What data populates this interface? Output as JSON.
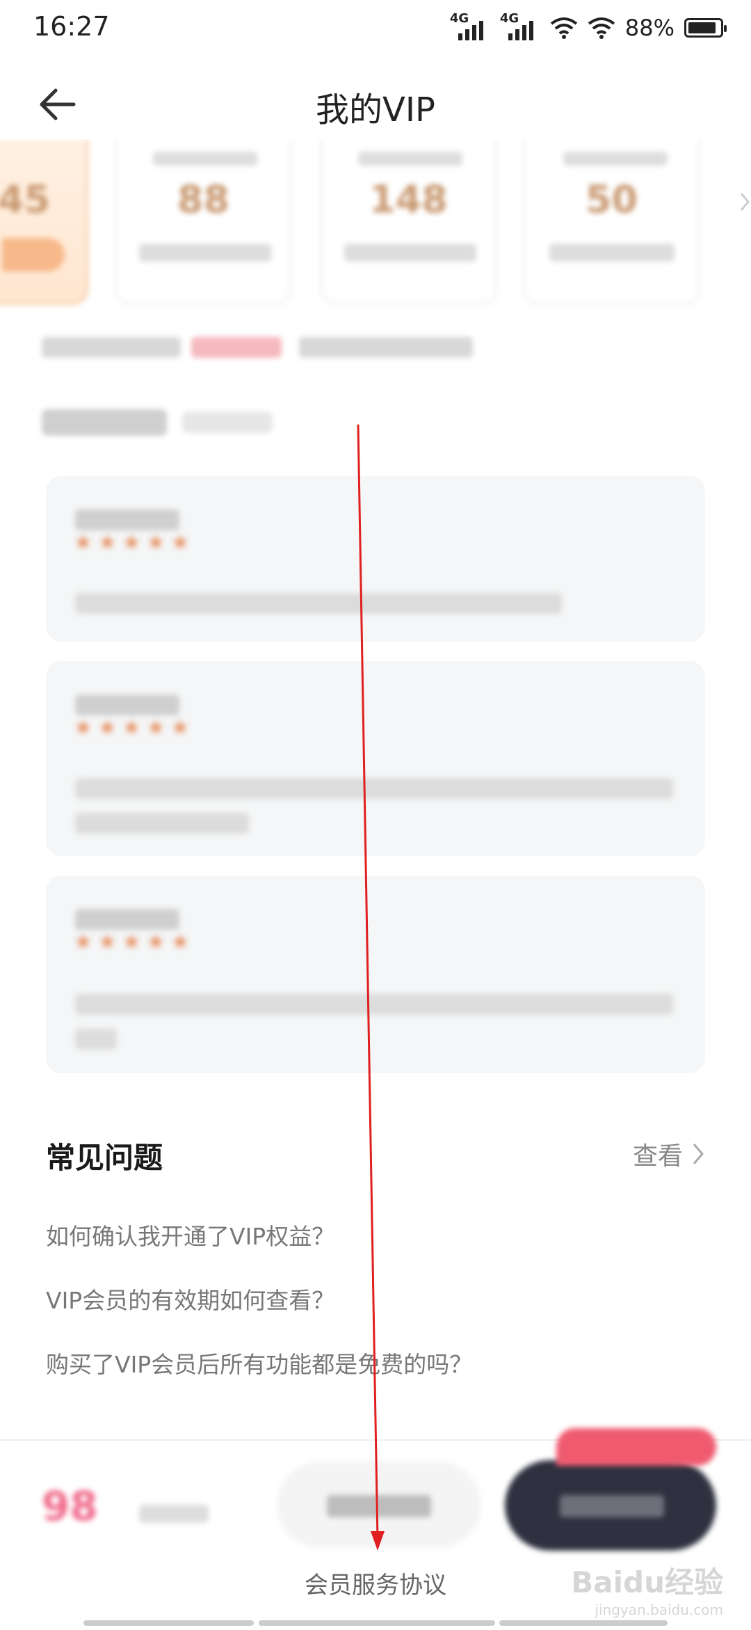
{
  "status_bar": {
    "time": "16:27",
    "net1": "4G",
    "net2": "4G",
    "battery_text": "88%",
    "battery_level": 0.88
  },
  "nav": {
    "title": "我的VIP"
  },
  "plans": [
    {
      "name": "",
      "price": "45",
      "desc": ""
    },
    {
      "name": "",
      "price": "88",
      "desc": ""
    },
    {
      "name": "",
      "price": "148",
      "desc": ""
    },
    {
      "name": "",
      "price": "50",
      "desc": ""
    }
  ],
  "promo": {
    "text": "",
    "highlight": ""
  },
  "reviews": {
    "header": "",
    "sub": "",
    "items": [
      {
        "user": "",
        "stars": "★★★★★",
        "text": ""
      },
      {
        "user": "",
        "stars": "★★★★★",
        "text": ""
      },
      {
        "user": "",
        "stars": "★★★★★",
        "text": ""
      }
    ]
  },
  "faq": {
    "title": "常见问题",
    "more": "查看",
    "items": [
      "如何确认我开通了VIP权益？",
      "VIP会员的有效期如何查看？",
      "购买了VIP会员后所有功能都是免费的吗？"
    ]
  },
  "bottom": {
    "price": "98",
    "original": "",
    "secondary_button": "",
    "primary_button": "",
    "badge": "",
    "agreement": "会员服务协议"
  },
  "watermark": {
    "brand": "Baidu经验",
    "url": "jingyan.baidu.com"
  },
  "colors": {
    "accent": "#c99a73",
    "primary_button": "#2f3140",
    "badge": "#ef5a6f",
    "annotation_arrow": "#e02020"
  }
}
